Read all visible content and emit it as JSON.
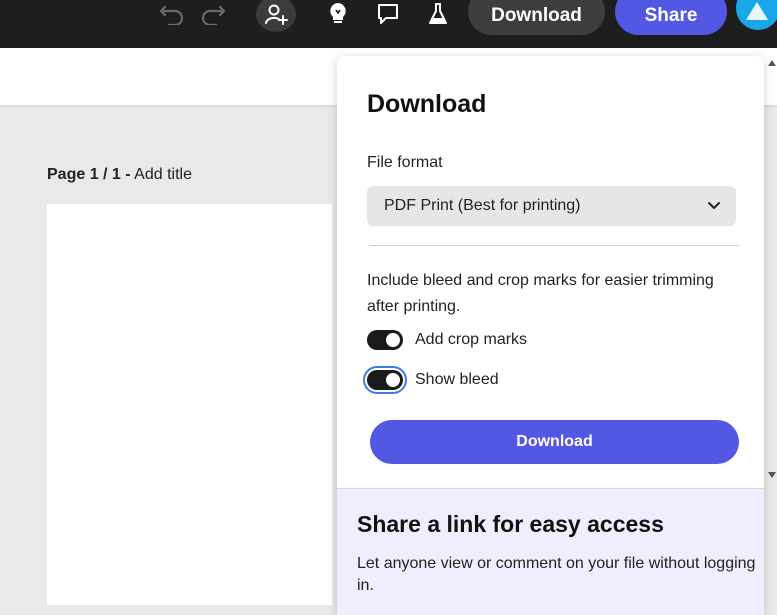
{
  "topbar": {
    "download_label": "Download",
    "share_label": "Share",
    "icons": [
      "undo-icon",
      "redo-icon",
      "invite-person-icon",
      "lightbulb-icon",
      "comment-icon",
      "flask-icon"
    ]
  },
  "canvas": {
    "page_number": "Page 1 / 1 -",
    "page_title_placeholder": "Add title"
  },
  "download_panel": {
    "title": "Download",
    "file_format_label": "File format",
    "file_format_value": "PDF Print (Best for printing)",
    "bleed_description": "Include bleed and crop marks for easier trimming after printing.",
    "toggles": [
      {
        "label": "Add crop marks",
        "on": true
      },
      {
        "label": "Show bleed",
        "on": true
      }
    ],
    "download_button": "Download"
  },
  "share_section": {
    "title": "Share a link for easy access",
    "description": "Let anyone view or comment on your file without logging in."
  },
  "colors": {
    "accent": "#5258e4",
    "topbar": "#1e1e1e",
    "share_bg": "#eeeeff"
  }
}
